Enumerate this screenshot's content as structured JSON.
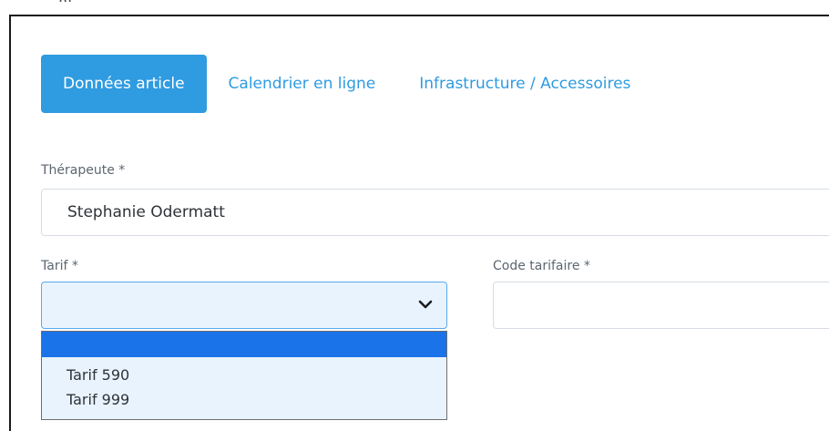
{
  "header_cut_text": "...",
  "tabs": [
    {
      "label": "Données article"
    },
    {
      "label": "Calendrier en ligne"
    },
    {
      "label": "Infrastructure / Accessoires"
    }
  ],
  "form": {
    "therapist": {
      "label": "Thérapeute *",
      "value": "Stephanie Odermatt"
    },
    "tarif": {
      "label": "Tarif *",
      "value": "",
      "options": [
        "",
        "Tarif 590",
        "Tarif 999"
      ]
    },
    "code_tarifaire": {
      "label": "Code tarifaire *",
      "value": ""
    }
  },
  "icons": {
    "select_chevron": "chevron-down-icon"
  },
  "colors": {
    "accent": "#2f9be0",
    "selected_option": "#1a73e8",
    "select_bg": "#e9f3fd"
  }
}
